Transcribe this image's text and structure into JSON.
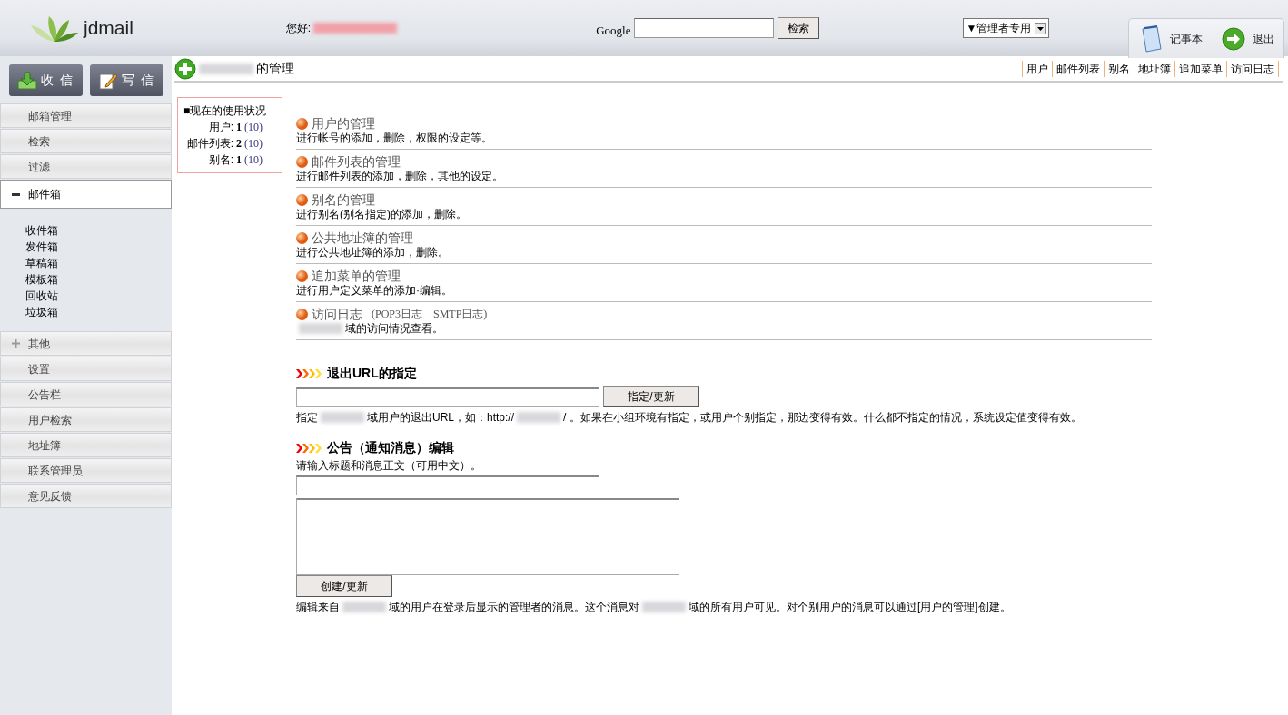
{
  "header": {
    "logo": "jdmail",
    "greeting": "您好:",
    "search_label": "Google",
    "search_button": "检索",
    "admin_select": "▼管理者专用",
    "tools": [
      {
        "kind": "notepad",
        "label": "记事本"
      },
      {
        "kind": "logout",
        "label": "退出"
      }
    ]
  },
  "sidebar": {
    "buttons": [
      {
        "kind": "inbox",
        "label": "收 信"
      },
      {
        "kind": "compose",
        "label": "写 信"
      }
    ],
    "menu": [
      {
        "label": "邮箱管理",
        "kind": "item"
      },
      {
        "label": "检索",
        "kind": "item"
      },
      {
        "label": "过滤",
        "kind": "item"
      },
      {
        "label": "邮件箱",
        "kind": "group",
        "expanded": true,
        "children": [
          {
            "label": "收件箱"
          },
          {
            "label": "发件箱"
          },
          {
            "label": "草稿箱"
          },
          {
            "label": "模板箱"
          },
          {
            "label": "回收站"
          },
          {
            "label": "垃圾箱"
          }
        ]
      },
      {
        "label": "其他",
        "kind": "group",
        "expanded": false
      },
      {
        "label": "设置",
        "kind": "item"
      },
      {
        "label": "公告栏",
        "kind": "item"
      },
      {
        "label": "用户检索",
        "kind": "item"
      },
      {
        "label": "地址簿",
        "kind": "item"
      },
      {
        "label": "联系管理员",
        "kind": "item"
      },
      {
        "label": "意见反馈",
        "kind": "item"
      }
    ]
  },
  "page_title": "的管理",
  "top_links": [
    "用户",
    "邮件列表",
    "别名",
    "地址簿",
    "追加菜单",
    "访问日志"
  ],
  "usage": {
    "title": "■现在的使用状况",
    "rows": [
      {
        "label": "用户:",
        "value": "1",
        "max": "(10)"
      },
      {
        "label": "邮件列表:",
        "value": "2",
        "max": "(10)"
      },
      {
        "label": "别名:",
        "value": "1",
        "max": "(10)"
      }
    ]
  },
  "sections": [
    {
      "title": "用户的管理",
      "description": [
        {
          "kind": "text",
          "text": "进行帐号的添加，删除，权限的设定等。"
        }
      ]
    },
    {
      "title": "邮件列表的管理",
      "description": [
        {
          "kind": "text",
          "text": "进行邮件列表的添加，删除，其他的设定。"
        }
      ]
    },
    {
      "title": "别名的管理",
      "description": [
        {
          "kind": "text",
          "text": "进行别名(别名指定)的添加，删除。"
        }
      ]
    },
    {
      "title": "公共地址簿的管理",
      "description": [
        {
          "kind": "text",
          "text": "进行公共地址簿的添加，删除。"
        }
      ]
    },
    {
      "title": "追加菜单的管理",
      "description": [
        {
          "kind": "text",
          "text": "进行用户定义菜单的添加·编辑。"
        }
      ]
    },
    {
      "title": "访问日志",
      "subtitle": "(POP3日志　SMTP日志)",
      "description": [
        {
          "kind": "redacted"
        },
        {
          "kind": "text",
          "text": "域的访问情况查看。"
        }
      ]
    }
  ],
  "exit_url": {
    "heading": "退出URL的指定",
    "button": "指定/更新",
    "hint": [
      {
        "kind": "text",
        "text": "指定"
      },
      {
        "kind": "redacted"
      },
      {
        "kind": "text",
        "text": "域用户的退出URL，如：http://"
      },
      {
        "kind": "redacted"
      },
      {
        "kind": "text",
        "text": "/ 。如果在小组环境有指定，或用户个别指定，那边变得有效。什么都不指定的情况，系统设定值变得有效。"
      }
    ]
  },
  "notice": {
    "heading": "公告（通知消息）编辑",
    "intro": "请输入标题和消息正文（可用中文）。",
    "button": "创建/更新",
    "hint": [
      {
        "kind": "text",
        "text": "编辑来自"
      },
      {
        "kind": "redacted"
      },
      {
        "kind": "text",
        "text": "域的用户在登录后显示的管理者的消息。这个消息对"
      },
      {
        "kind": "redacted"
      },
      {
        "kind": "text",
        "text": "域的所有用户可见。对个别用户的消息可以通过[用户的管理]创建。"
      }
    ]
  }
}
